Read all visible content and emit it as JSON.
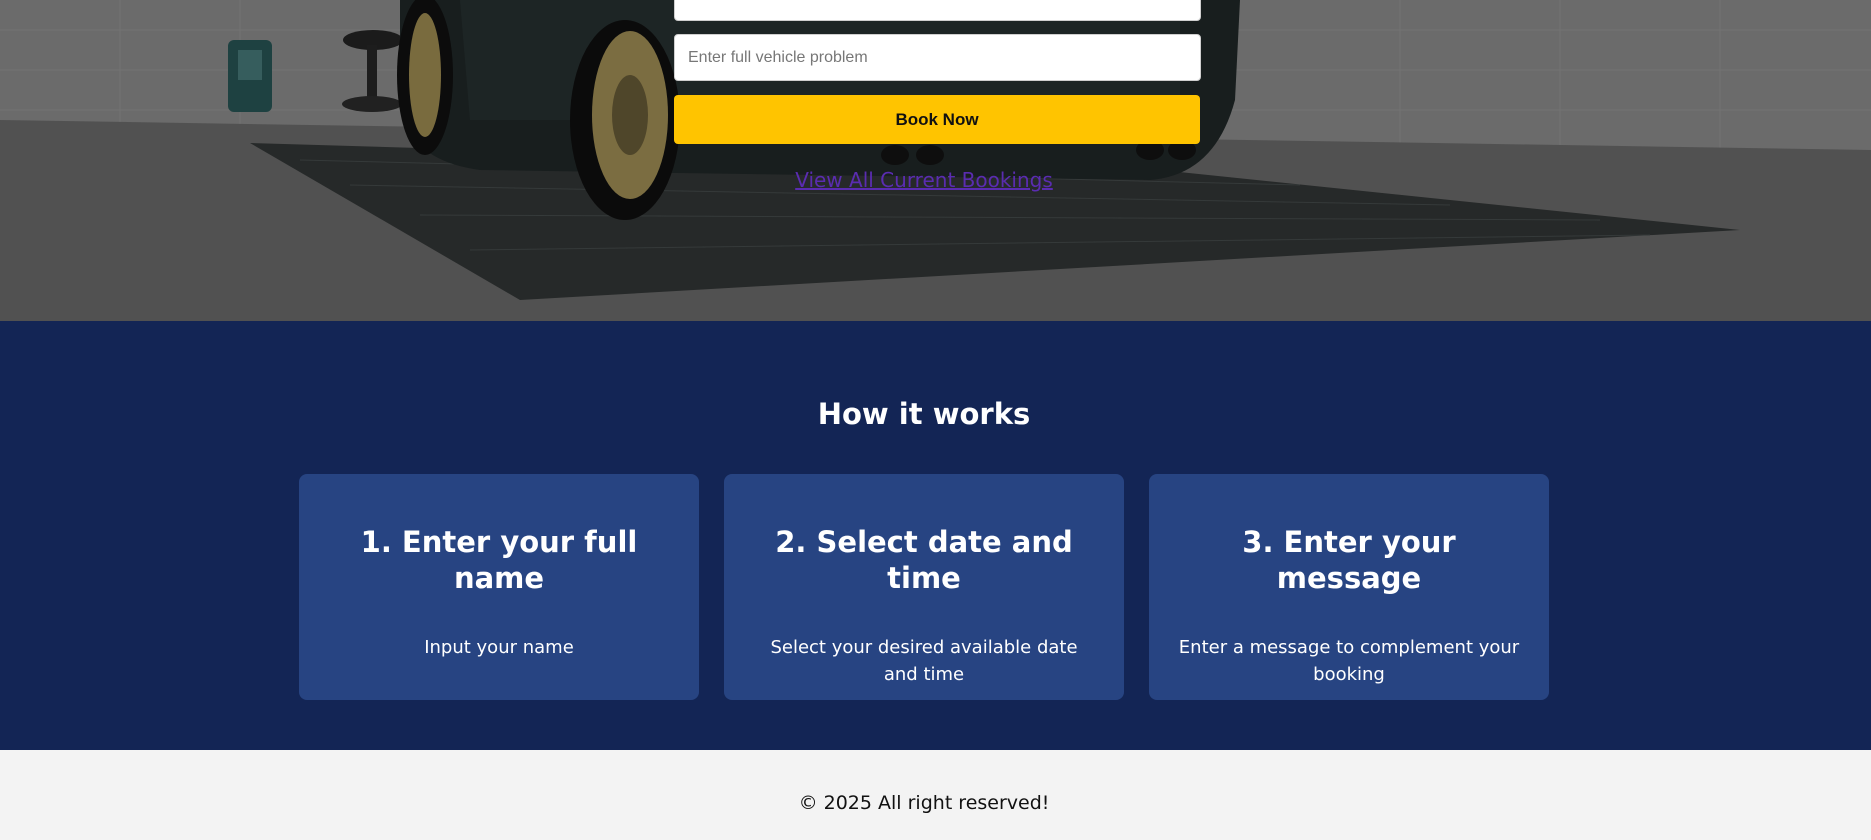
{
  "booking_form": {
    "top_input_value": "",
    "problem_placeholder": "Enter full vehicle problem",
    "book_button_label": "Book Now",
    "view_bookings_link": "View All Current Bookings"
  },
  "how_it_works": {
    "title": "How it works",
    "steps": [
      {
        "title": "1. Enter your full name",
        "description": "Input your name"
      },
      {
        "title": "2. Select date and time",
        "description": "Select your desired available date and time"
      },
      {
        "title": "3. Enter your message",
        "description": "Enter a message to complement your booking"
      }
    ]
  },
  "footer": {
    "copyright": "© 2025 All right reserved!"
  },
  "colors": {
    "accent_button": "#ffc400",
    "section_bg": "#132555",
    "card_bg": "#274482",
    "link": "#5a2cb0",
    "footer_bg": "#f3f3f3"
  }
}
